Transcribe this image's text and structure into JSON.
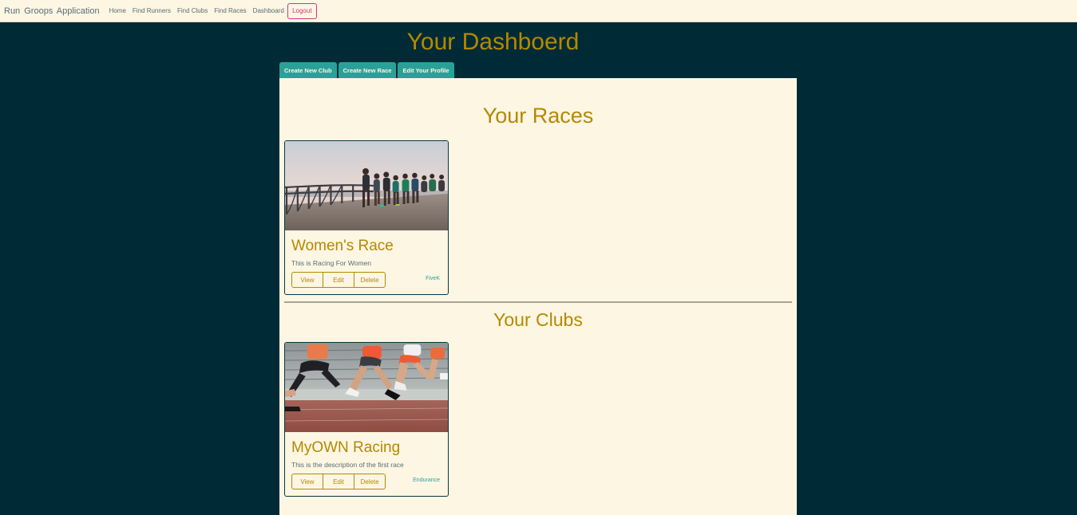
{
  "navbar": {
    "brand": "Run Groops Application",
    "links": [
      "Home",
      "Find Runners",
      "Find Clubs",
      "Find Races",
      "Dashboard"
    ],
    "logout_label": "Logout"
  },
  "page": {
    "title": "Your Dashboerd"
  },
  "actions": {
    "create_club": "Create New Club",
    "create_race": "Create New Race",
    "edit_profile": "Edit Your Profile"
  },
  "races": {
    "title": "Your Races",
    "items": [
      {
        "title": "Women's Race",
        "description": "This is Racing For Women",
        "category": "FiveK",
        "view_label": "View",
        "edit_label": "Edit",
        "delete_label": "Delete"
      }
    ]
  },
  "clubs": {
    "title": "Your Clubs",
    "items": [
      {
        "title": "MyOWN Racing",
        "description": "This is the description of the first race",
        "category": "Endurance",
        "view_label": "View",
        "edit_label": "Edit",
        "delete_label": "Delete"
      }
    ]
  },
  "colors": {
    "background": "#002b36",
    "panel": "#fdf6e3",
    "accent": "#b58900",
    "teal": "#2aa198",
    "logout": "#d33682"
  }
}
